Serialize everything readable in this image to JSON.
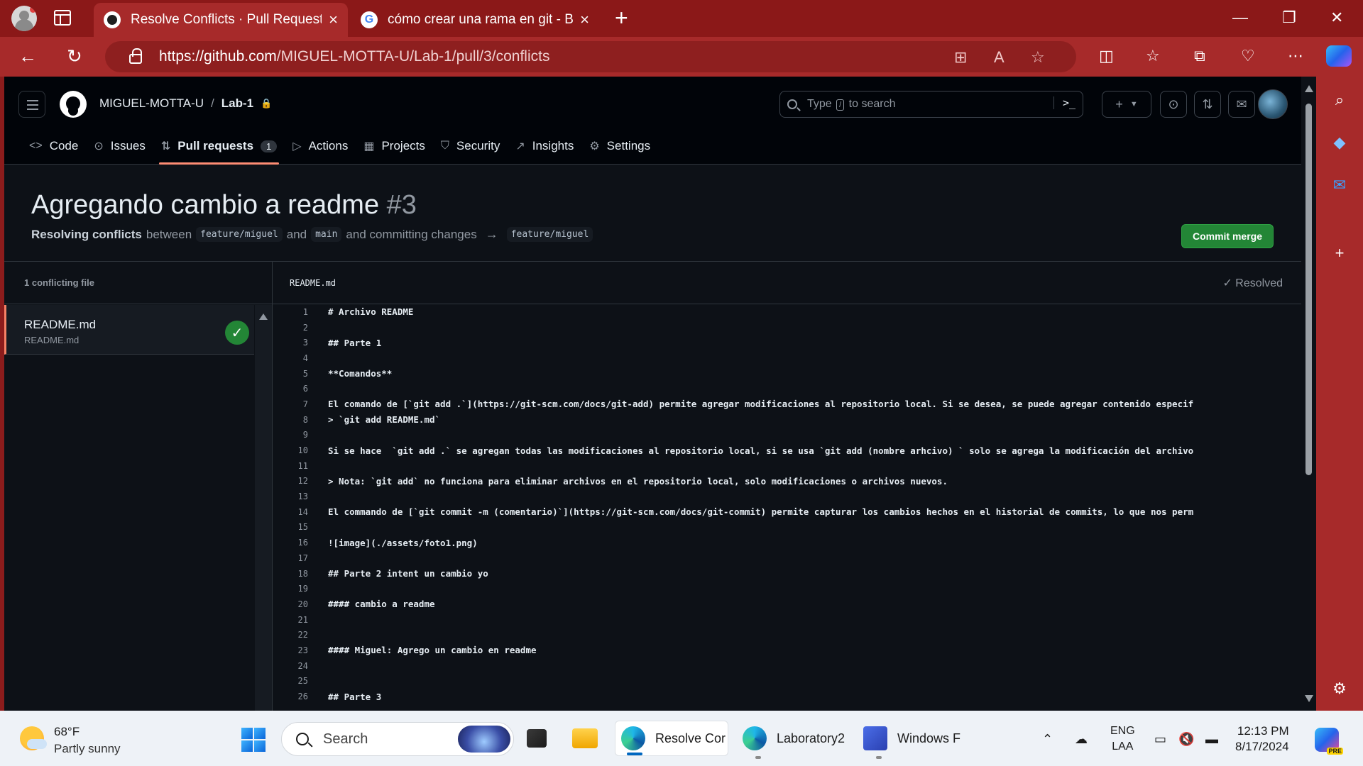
{
  "browser": {
    "tabs": [
      {
        "title": "Resolve Conflicts · Pull Request #",
        "favicon": "github-icon",
        "active": true
      },
      {
        "title": "cómo crear una rama en git - Bu",
        "favicon": "google-icon",
        "active": false
      }
    ],
    "url_host": "https://github.com",
    "url_path": "/MIGUEL-MOTTA-U/Lab-1/pull/3/conflicts"
  },
  "header": {
    "owner": "MIGUEL-MOTTA-U",
    "separator": "/",
    "repo": "Lab-1",
    "search_prefix": "Type",
    "search_key": "/",
    "search_suffix": "to search",
    "command_glyph": ">_"
  },
  "repo_nav": [
    {
      "label": "Code",
      "icon": "code-icon",
      "glyph": "<>"
    },
    {
      "label": "Issues",
      "icon": "issue-icon",
      "glyph": "⊙"
    },
    {
      "label": "Pull requests",
      "icon": "pull-request-icon",
      "glyph": "⇅",
      "count": "1",
      "selected": true
    },
    {
      "label": "Actions",
      "icon": "play-icon",
      "glyph": "▷"
    },
    {
      "label": "Projects",
      "icon": "table-icon",
      "glyph": "▦"
    },
    {
      "label": "Security",
      "icon": "shield-icon",
      "glyph": "⛉"
    },
    {
      "label": "Insights",
      "icon": "graph-icon",
      "glyph": "↗"
    },
    {
      "label": "Settings",
      "icon": "gear-icon",
      "glyph": "⚙"
    }
  ],
  "pr": {
    "title": "Agregando cambio a readme",
    "number": "#3",
    "resolving_label": "Resolving conflicts",
    "between": "between",
    "branch_head": "feature/miguel",
    "and": "and",
    "branch_base": "main",
    "committing": "and committing changes",
    "branch_target": "feature/miguel",
    "commit_button": "Commit merge"
  },
  "conflicts": {
    "header": "1 conflicting file",
    "files": [
      {
        "name": "README.md",
        "path": "README.md",
        "resolved": true
      }
    ]
  },
  "editor": {
    "file": "README.md",
    "resolved_label": "Resolved",
    "lines": [
      {
        "n": "1",
        "text": "# Archivo README"
      },
      {
        "n": "2",
        "text": ""
      },
      {
        "n": "3",
        "text": "## Parte 1"
      },
      {
        "n": "4",
        "text": ""
      },
      {
        "n": "5",
        "text": "**Comandos**"
      },
      {
        "n": "6",
        "text": ""
      },
      {
        "n": "7",
        "text": "El comando de [`git add .`](https://git-scm.com/docs/git-add) permite agregar modificaciones al repositorio local. Si se desea, se puede agregar contenido especif"
      },
      {
        "n": "8",
        "text": "> `git add README.md`"
      },
      {
        "n": "9",
        "text": ""
      },
      {
        "n": "10",
        "text": "Si se hace  `git add .` se agregan todas las modificaciones al repositorio local, si se usa `git add (nombre arhcivo) ` solo se agrega la modificación del archivo"
      },
      {
        "n": "11",
        "text": ""
      },
      {
        "n": "12",
        "text": "> Nota: `git add` no funciona para eliminar archivos en el repositorio local, solo modificaciones o archivos nuevos."
      },
      {
        "n": "13",
        "text": ""
      },
      {
        "n": "14",
        "text": "El commando de [`git commit -m (comentario)`](https://git-scm.com/docs/git-commit) permite capturar los cambios hechos en el historial de commits, lo que nos perm"
      },
      {
        "n": "15",
        "text": ""
      },
      {
        "n": "16",
        "text": "![image](./assets/foto1.png)"
      },
      {
        "n": "17",
        "text": ""
      },
      {
        "n": "18",
        "text": "## Parte 2 intent un cambio yo"
      },
      {
        "n": "19",
        "text": ""
      },
      {
        "n": "20",
        "text": "#### cambio a readme"
      },
      {
        "n": "21",
        "text": ""
      },
      {
        "n": "22",
        "text": ""
      },
      {
        "n": "23",
        "text": "#### Miguel: Agrego un cambio en readme"
      },
      {
        "n": "24",
        "text": ""
      },
      {
        "n": "25",
        "text": ""
      },
      {
        "n": "26",
        "text": "## Parte 3"
      }
    ]
  },
  "taskbar": {
    "temp": "68°F",
    "weather": "Partly sunny",
    "search_placeholder": "Search",
    "apps": [
      {
        "label": "Resolve Cor",
        "icon": "edge-icon",
        "active": true
      },
      {
        "label": "Laboratory2",
        "icon": "edge-icon",
        "active": false
      },
      {
        "label": "Windows F",
        "icon": "powershell-icon",
        "active": false
      }
    ],
    "lang1": "ENG",
    "lang2": "LAA",
    "time": "12:13 PM",
    "date": "8/17/2024",
    "copilot_badge": "PRE"
  },
  "colors": {
    "browser_frame": "#a72a2a",
    "merge_button": "#238636",
    "selected_tab_underline": "#fd8c73"
  }
}
